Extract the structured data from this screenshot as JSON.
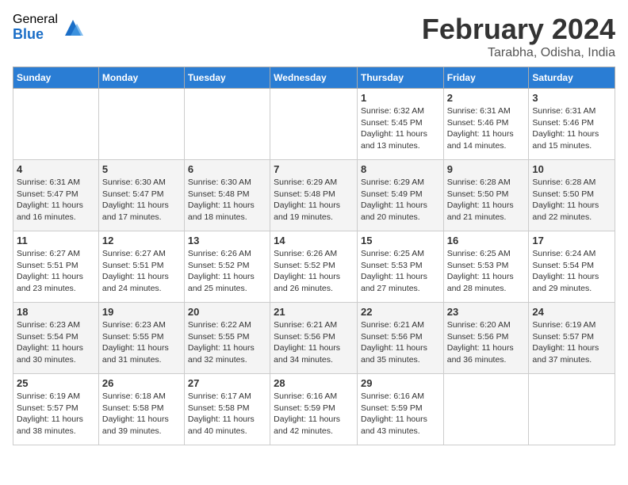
{
  "logo": {
    "general": "General",
    "blue": "Blue"
  },
  "header": {
    "title": "February 2024",
    "subtitle": "Tarabha, Odisha, India"
  },
  "days_of_week": [
    "Sunday",
    "Monday",
    "Tuesday",
    "Wednesday",
    "Thursday",
    "Friday",
    "Saturday"
  ],
  "weeks": [
    [
      {
        "day": "",
        "info": ""
      },
      {
        "day": "",
        "info": ""
      },
      {
        "day": "",
        "info": ""
      },
      {
        "day": "",
        "info": ""
      },
      {
        "day": "1",
        "info": "Sunrise: 6:32 AM\nSunset: 5:45 PM\nDaylight: 11 hours and 13 minutes."
      },
      {
        "day": "2",
        "info": "Sunrise: 6:31 AM\nSunset: 5:46 PM\nDaylight: 11 hours and 14 minutes."
      },
      {
        "day": "3",
        "info": "Sunrise: 6:31 AM\nSunset: 5:46 PM\nDaylight: 11 hours and 15 minutes."
      }
    ],
    [
      {
        "day": "4",
        "info": "Sunrise: 6:31 AM\nSunset: 5:47 PM\nDaylight: 11 hours and 16 minutes."
      },
      {
        "day": "5",
        "info": "Sunrise: 6:30 AM\nSunset: 5:47 PM\nDaylight: 11 hours and 17 minutes."
      },
      {
        "day": "6",
        "info": "Sunrise: 6:30 AM\nSunset: 5:48 PM\nDaylight: 11 hours and 18 minutes."
      },
      {
        "day": "7",
        "info": "Sunrise: 6:29 AM\nSunset: 5:48 PM\nDaylight: 11 hours and 19 minutes."
      },
      {
        "day": "8",
        "info": "Sunrise: 6:29 AM\nSunset: 5:49 PM\nDaylight: 11 hours and 20 minutes."
      },
      {
        "day": "9",
        "info": "Sunrise: 6:28 AM\nSunset: 5:50 PM\nDaylight: 11 hours and 21 minutes."
      },
      {
        "day": "10",
        "info": "Sunrise: 6:28 AM\nSunset: 5:50 PM\nDaylight: 11 hours and 22 minutes."
      }
    ],
    [
      {
        "day": "11",
        "info": "Sunrise: 6:27 AM\nSunset: 5:51 PM\nDaylight: 11 hours and 23 minutes."
      },
      {
        "day": "12",
        "info": "Sunrise: 6:27 AM\nSunset: 5:51 PM\nDaylight: 11 hours and 24 minutes."
      },
      {
        "day": "13",
        "info": "Sunrise: 6:26 AM\nSunset: 5:52 PM\nDaylight: 11 hours and 25 minutes."
      },
      {
        "day": "14",
        "info": "Sunrise: 6:26 AM\nSunset: 5:52 PM\nDaylight: 11 hours and 26 minutes."
      },
      {
        "day": "15",
        "info": "Sunrise: 6:25 AM\nSunset: 5:53 PM\nDaylight: 11 hours and 27 minutes."
      },
      {
        "day": "16",
        "info": "Sunrise: 6:25 AM\nSunset: 5:53 PM\nDaylight: 11 hours and 28 minutes."
      },
      {
        "day": "17",
        "info": "Sunrise: 6:24 AM\nSunset: 5:54 PM\nDaylight: 11 hours and 29 minutes."
      }
    ],
    [
      {
        "day": "18",
        "info": "Sunrise: 6:23 AM\nSunset: 5:54 PM\nDaylight: 11 hours and 30 minutes."
      },
      {
        "day": "19",
        "info": "Sunrise: 6:23 AM\nSunset: 5:55 PM\nDaylight: 11 hours and 31 minutes."
      },
      {
        "day": "20",
        "info": "Sunrise: 6:22 AM\nSunset: 5:55 PM\nDaylight: 11 hours and 32 minutes."
      },
      {
        "day": "21",
        "info": "Sunrise: 6:21 AM\nSunset: 5:56 PM\nDaylight: 11 hours and 34 minutes."
      },
      {
        "day": "22",
        "info": "Sunrise: 6:21 AM\nSunset: 5:56 PM\nDaylight: 11 hours and 35 minutes."
      },
      {
        "day": "23",
        "info": "Sunrise: 6:20 AM\nSunset: 5:56 PM\nDaylight: 11 hours and 36 minutes."
      },
      {
        "day": "24",
        "info": "Sunrise: 6:19 AM\nSunset: 5:57 PM\nDaylight: 11 hours and 37 minutes."
      }
    ],
    [
      {
        "day": "25",
        "info": "Sunrise: 6:19 AM\nSunset: 5:57 PM\nDaylight: 11 hours and 38 minutes."
      },
      {
        "day": "26",
        "info": "Sunrise: 6:18 AM\nSunset: 5:58 PM\nDaylight: 11 hours and 39 minutes."
      },
      {
        "day": "27",
        "info": "Sunrise: 6:17 AM\nSunset: 5:58 PM\nDaylight: 11 hours and 40 minutes."
      },
      {
        "day": "28",
        "info": "Sunrise: 6:16 AM\nSunset: 5:59 PM\nDaylight: 11 hours and 42 minutes."
      },
      {
        "day": "29",
        "info": "Sunrise: 6:16 AM\nSunset: 5:59 PM\nDaylight: 11 hours and 43 minutes."
      },
      {
        "day": "",
        "info": ""
      },
      {
        "day": "",
        "info": ""
      }
    ]
  ]
}
